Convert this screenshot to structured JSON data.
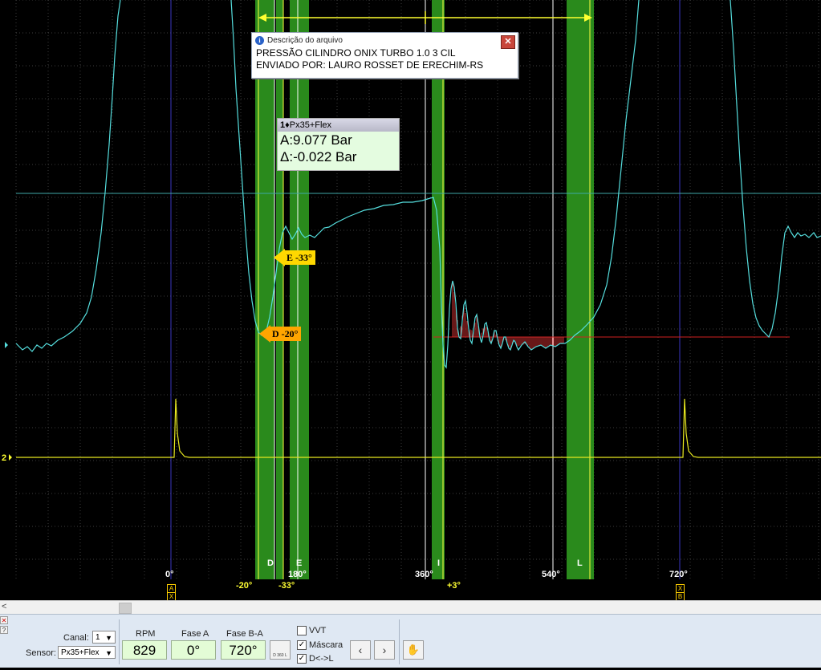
{
  "scope": {
    "description_dialog": {
      "title": "Descrição do arquivo",
      "line1": "PRESSÃO CILINDRO ONIX TURBO 1.0 3 CIL",
      "line2": "ENVIADO POR: LAURO ROSSET DE ERECHIM-RS",
      "close_glyph": "✕"
    },
    "reading": {
      "channel": "1",
      "sensor": "Px35+Flex",
      "a_value": "A:9.077 Bar",
      "delta_value": "Δ:-0.022 Bar"
    },
    "markers": {
      "e_label": "E -33°",
      "d_label": "D -20°"
    },
    "channel_marker": "2",
    "zone_letters": [
      "D",
      "E",
      "I",
      "L"
    ],
    "degree_labels": [
      "0°",
      "180°",
      "360°",
      "540°",
      "720°"
    ],
    "yellow_labels": [
      "-20°",
      "-33°",
      "+3°"
    ],
    "cursor_labels": [
      "A",
      "X",
      "X",
      "B"
    ]
  },
  "toolbar": {
    "canal_label": "Canal:",
    "canal_value": "1",
    "sensor_label": "Sensor:",
    "sensor_value": "Px35+Flex",
    "rpm_label": "RPM",
    "rpm_value": "829",
    "fase_a_label": "Fase A",
    "fase_a_value": "0°",
    "fase_ba_label": "Fase B-A",
    "fase_ba_value": "720°",
    "span_button_label": "D 360 L",
    "vvt_label": "VVT",
    "vvt_checked": false,
    "mascara_label": "Máscara",
    "mascara_checked": true,
    "dl_label": "D<->L",
    "dl_checked": true,
    "prev_label": "‹",
    "next_label": "›",
    "hand_icon": "hand-icon"
  },
  "colors": {
    "trace_pressure": "#55e0e0",
    "trace_sync": "#e8e820",
    "zone_green": "#2a8a1c",
    "grid": "#3a3a3a",
    "mask_red": "#d02020",
    "marker_e": "#ffd800",
    "marker_d": "#ffa500"
  }
}
